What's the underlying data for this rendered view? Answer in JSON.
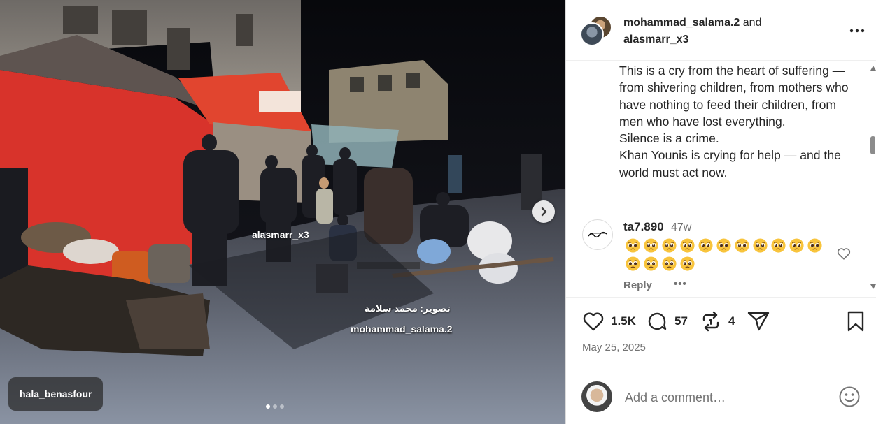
{
  "post": {
    "photo_tag_overlay": "alasmarr_x3",
    "photo_caption_arabic": "تصوير: محمد سلامة",
    "photo_caption_handle": "mohammad_salama.2",
    "photo_user_tag": "hala_benasfour",
    "carousel_dots": 3,
    "carousel_active": 0
  },
  "header": {
    "user1": "mohammad_salama.2",
    "joiner": "and",
    "user2": "alasmarr_x3"
  },
  "caption_lines": [
    "This is a cry from the heart of suffering — from shivering children, from mothers who have nothing to feed their children, from men who have lost everything.",
    "Silence is a crime.",
    "Khan Younis is crying for help — and the world must act now."
  ],
  "comment": {
    "username": "ta7.890",
    "time": "47w",
    "emoji_count": 15,
    "emoji": "pleading-face",
    "reply_label": "Reply",
    "more_label": "•••"
  },
  "actions": {
    "likes": "1.5K",
    "comments": "57",
    "reposts": "4"
  },
  "date": "May 25, 2025",
  "comment_input": {
    "placeholder": "Add a comment…"
  },
  "colors": {
    "text": "#262626",
    "muted": "#737373",
    "border": "#dbdbdb"
  }
}
